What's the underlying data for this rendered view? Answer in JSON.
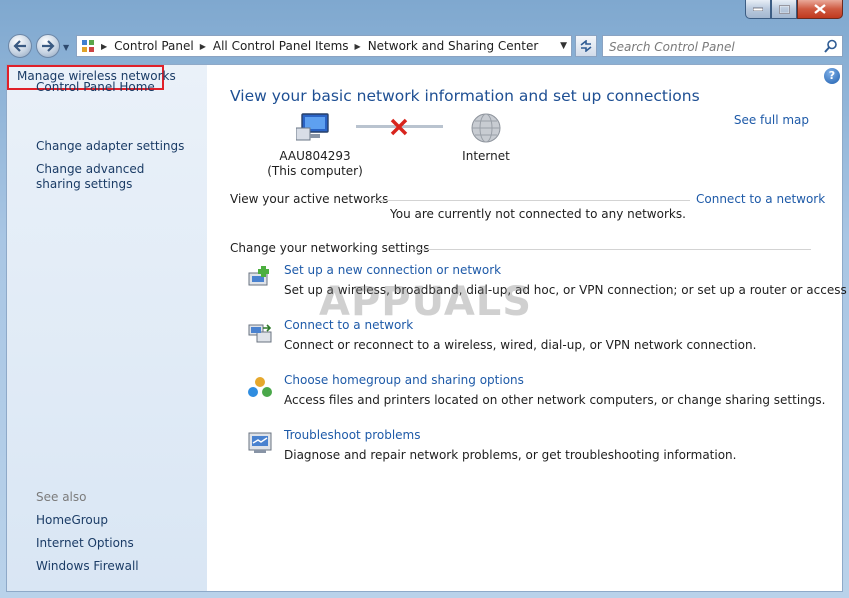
{
  "window": {
    "caption_buttons": [
      "minimize",
      "maximize",
      "close"
    ]
  },
  "nav": {
    "breadcrumb": [
      "Control Panel",
      "All Control Panel Items",
      "Network and Sharing Center"
    ],
    "search_placeholder": "Search Control Panel"
  },
  "sidebar": {
    "home": "Control Panel Home",
    "links": [
      "Manage wireless networks",
      "Change adapter settings",
      "Change advanced sharing settings"
    ],
    "see_also_title": "See also",
    "see_also": [
      "HomeGroup",
      "Internet Options",
      "Windows Firewall"
    ]
  },
  "main": {
    "title": "View your basic network information and set up connections",
    "see_full_map": "See full map",
    "computer_name": "AAU804293",
    "computer_sub": "(This computer)",
    "internet_label": "Internet",
    "active_networks_header": "View your active networks",
    "connect_link": "Connect to a network",
    "not_connected": "You are currently not connected to any networks.",
    "settings_header": "Change your networking settings",
    "tasks": [
      {
        "icon": "new-connection-icon",
        "link": "Set up a new connection or network",
        "desc": "Set up a wireless, broadband, dial-up, ad hoc, or VPN connection; or set up a router or access point."
      },
      {
        "icon": "connect-network-icon",
        "link": "Connect to a network",
        "desc": "Connect or reconnect to a wireless, wired, dial-up, or VPN network connection."
      },
      {
        "icon": "homegroup-icon",
        "link": "Choose homegroup and sharing options",
        "desc": "Access files and printers located on other network computers, or change sharing settings."
      },
      {
        "icon": "troubleshoot-icon",
        "link": "Troubleshoot problems",
        "desc": "Diagnose and repair network problems, or get troubleshooting information."
      }
    ],
    "watermark": "APPUALS"
  },
  "colors": {
    "link": "#1e5aa8",
    "title": "#1e4f93",
    "highlight_box": "#e0202a",
    "sidebar_bg": "#dde8f5"
  }
}
